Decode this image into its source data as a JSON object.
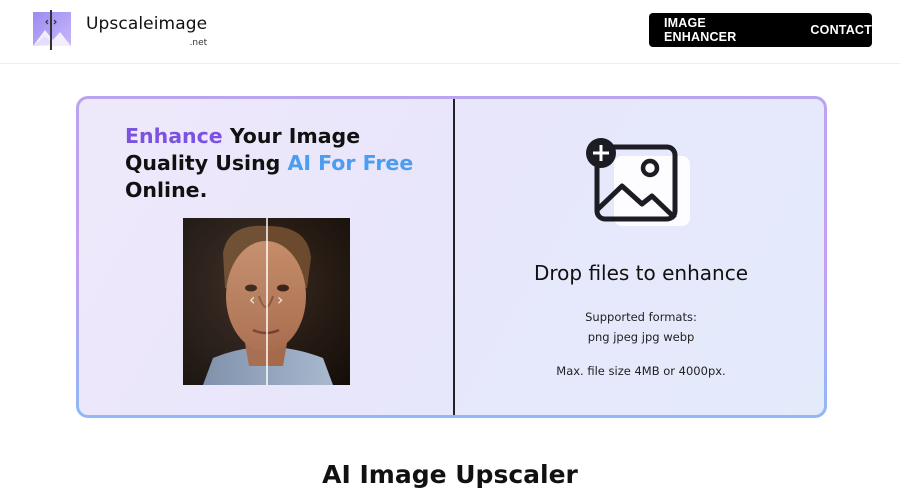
{
  "brand": {
    "name": "Upscaleimage",
    "suffix": ".net",
    "icon": "logo-mountain-icon"
  },
  "nav": {
    "items": [
      "IMAGE ENHANCER",
      "CONTACT"
    ]
  },
  "hero": {
    "headline_part1": "Enhance",
    "headline_part2": " Your Image Quality Using ",
    "headline_part3": "AI For Free",
    "headline_part4": " Online.",
    "compare_prev": "‹",
    "compare_next": "›"
  },
  "dropzone": {
    "title": "Drop files to enhance",
    "formats_label": "Supported formats:",
    "formats_list": "png jpeg jpg webp",
    "max_size": "Max. file size 4MB or 4000px.",
    "icon": "add-image-icon"
  },
  "section": {
    "title": "AI Image Upscaler"
  },
  "colors": {
    "accent_purple": "#7b53e0",
    "accent_blue": "#4a9df0",
    "nav_bg": "#000000"
  }
}
